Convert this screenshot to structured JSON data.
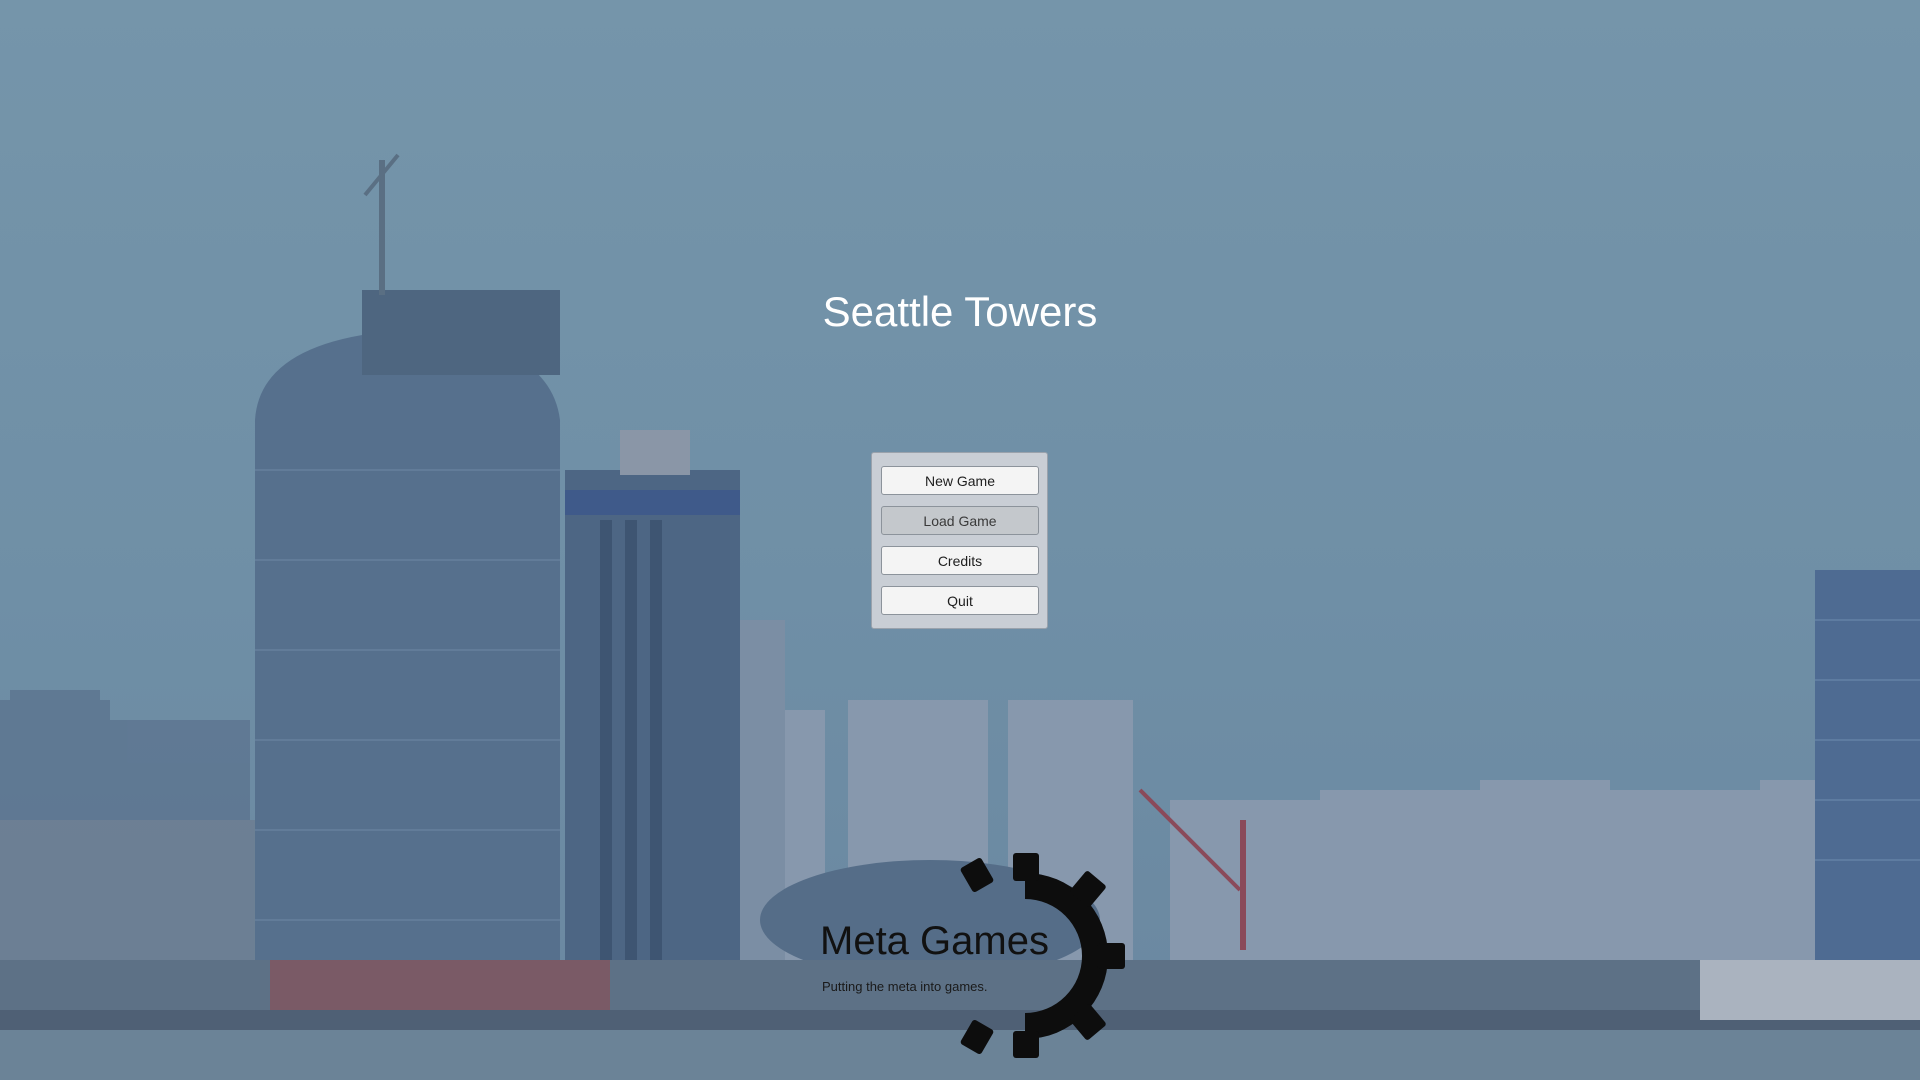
{
  "title": "Seattle Towers",
  "menu": {
    "items": [
      {
        "label": "New Game",
        "enabled": true
      },
      {
        "label": "Load Game",
        "enabled": false
      },
      {
        "label": "Credits",
        "enabled": true
      },
      {
        "label": "Quit",
        "enabled": true
      }
    ]
  },
  "brand": {
    "name": "Meta Games",
    "tagline": "Putting the meta into games.",
    "logo_icon": "gear-icon"
  },
  "background": {
    "scene": "city-skyline-waterfront",
    "sky_color": "#7595aa",
    "water_color": "#6b8397"
  }
}
